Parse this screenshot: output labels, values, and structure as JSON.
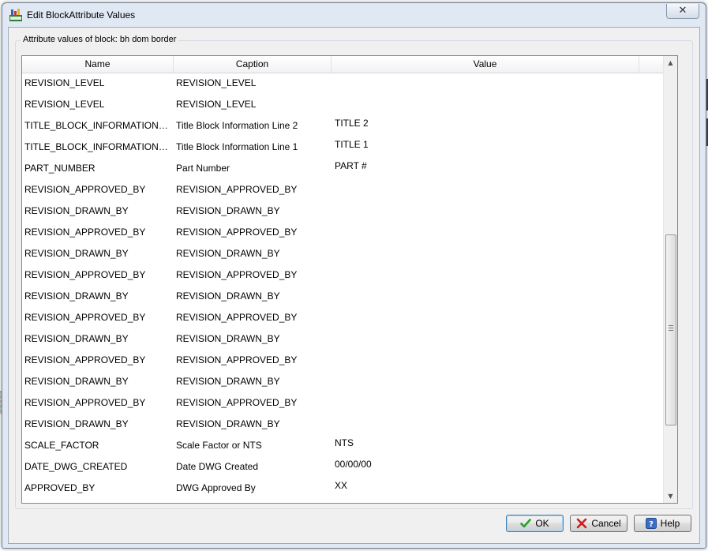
{
  "window": {
    "title": "Edit BlockAttribute Values",
    "close_glyph": "✕"
  },
  "group": {
    "label": "Attribute values of block: bh dom border"
  },
  "grid": {
    "columns": [
      "Name",
      "Caption",
      "Value"
    ],
    "rows": [
      {
        "name": "REVISION_LEVEL",
        "caption": "REVISION_LEVEL",
        "value": ""
      },
      {
        "name": "REVISION_LEVEL",
        "caption": "REVISION_LEVEL",
        "value": ""
      },
      {
        "name": "TITLE_BLOCK_INFORMATION_LI...",
        "caption": "Title Block Information Line 2",
        "value": "TITLE 2"
      },
      {
        "name": "TITLE_BLOCK_INFORMATION_LI...",
        "caption": "Title Block Information Line 1",
        "value": "TITLE 1"
      },
      {
        "name": "PART_NUMBER",
        "caption": "Part Number",
        "value": "PART #"
      },
      {
        "name": "REVISION_APPROVED_BY",
        "caption": "REVISION_APPROVED_BY",
        "value": ""
      },
      {
        "name": "REVISION_DRAWN_BY",
        "caption": "REVISION_DRAWN_BY",
        "value": ""
      },
      {
        "name": "REVISION_APPROVED_BY",
        "caption": "REVISION_APPROVED_BY",
        "value": ""
      },
      {
        "name": "REVISION_DRAWN_BY",
        "caption": "REVISION_DRAWN_BY",
        "value": ""
      },
      {
        "name": "REVISION_APPROVED_BY",
        "caption": "REVISION_APPROVED_BY",
        "value": ""
      },
      {
        "name": "REVISION_DRAWN_BY",
        "caption": "REVISION_DRAWN_BY",
        "value": ""
      },
      {
        "name": "REVISION_APPROVED_BY",
        "caption": "REVISION_APPROVED_BY",
        "value": ""
      },
      {
        "name": "REVISION_DRAWN_BY",
        "caption": "REVISION_DRAWN_BY",
        "value": ""
      },
      {
        "name": "REVISION_APPROVED_BY",
        "caption": "REVISION_APPROVED_BY",
        "value": ""
      },
      {
        "name": "REVISION_DRAWN_BY",
        "caption": "REVISION_DRAWN_BY",
        "value": ""
      },
      {
        "name": "REVISION_APPROVED_BY",
        "caption": "REVISION_APPROVED_BY",
        "value": ""
      },
      {
        "name": "REVISION_DRAWN_BY",
        "caption": "REVISION_DRAWN_BY",
        "value": ""
      },
      {
        "name": "SCALE_FACTOR",
        "caption": "Scale Factor or NTS",
        "value": "NTS"
      },
      {
        "name": "DATE_DWG_CREATED",
        "caption": "Date DWG Created",
        "value": "00/00/00"
      },
      {
        "name": "APPROVED_BY",
        "caption": "DWG Approved By",
        "value": "XX"
      }
    ]
  },
  "buttons": {
    "ok_label": "OK",
    "cancel_label": "Cancel",
    "help_label": "Help"
  },
  "icons": {
    "app": "block-attribute-icon",
    "ok": "green-check-icon",
    "cancel": "red-x-icon",
    "help": "question-mark-icon",
    "scroll_up": "scroll-up-arrow-icon",
    "scroll_down": "scroll-down-arrow-icon"
  },
  "colors": {
    "ok_check": "#2aa02a",
    "cancel_x": "#d01c1c",
    "help_bg": "#3a6fc4",
    "title_bar": "#dfe8f3"
  }
}
